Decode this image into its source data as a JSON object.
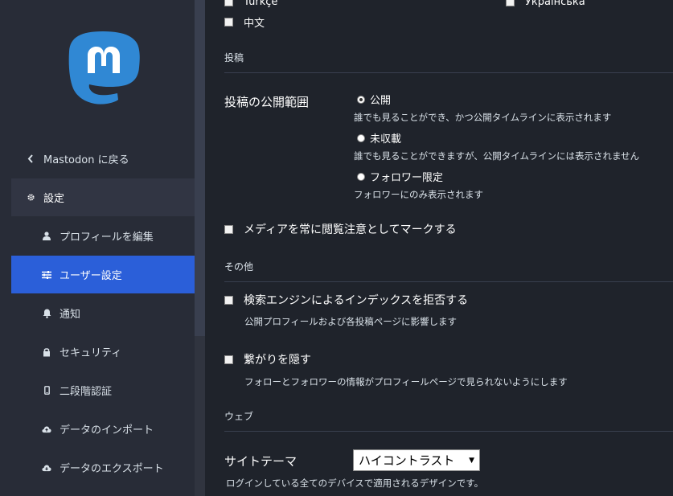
{
  "sidebar": {
    "back_label": "Mastodon に戻る",
    "group_label": "設定",
    "items": [
      {
        "label": "プロフィールを編集",
        "icon": "user-icon"
      },
      {
        "label": "ユーザー設定",
        "icon": "sliders-icon",
        "active": true
      },
      {
        "label": "通知",
        "icon": "bell-icon"
      },
      {
        "label": "セキュリティ",
        "icon": "lock-icon"
      },
      {
        "label": "二段階認証",
        "icon": "mobile-icon"
      },
      {
        "label": "データのインポート",
        "icon": "cloud-upload-icon"
      },
      {
        "label": "データのエクスポート",
        "icon": "cloud-download-icon"
      }
    ]
  },
  "languages": {
    "turkish": "Türkçe",
    "ukrainian": "Українська",
    "chinese": "中文"
  },
  "sections": {
    "post": "投稿",
    "other": "その他",
    "web": "ウェブ"
  },
  "privacy": {
    "label": "投稿の公開範囲",
    "options": [
      {
        "label": "公開",
        "hint": "誰でも見ることができ、かつ公開タイムラインに表示されます",
        "checked": true
      },
      {
        "label": "未収載",
        "hint": "誰でも見ることができますが、公開タイムラインには表示されません",
        "checked": false
      },
      {
        "label": "フォロワー限定",
        "hint": "フォロワーにのみ表示されます",
        "checked": false
      }
    ]
  },
  "media_sensitive": "メディアを常に閲覧注意としてマークする",
  "noindex": {
    "label": "検索エンジンによるインデックスを拒否する",
    "hint": "公開プロフィールおよび各投稿ページに影響します"
  },
  "hide_network": {
    "label": "繋がりを隠す",
    "hint": "フォローとフォロワーの情報がプロフィールページで見られないようにします"
  },
  "theme": {
    "label": "サイトテーマ",
    "value": "ハイコントラスト",
    "hint": "ログインしている全てのデバイスで適用されるデザインです。"
  },
  "colors": {
    "accent": "#2b5fd9",
    "logo": "#3088d4"
  }
}
